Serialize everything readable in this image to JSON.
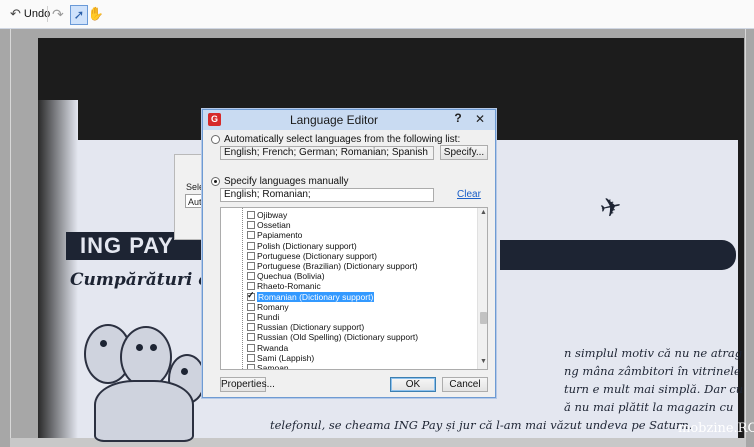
{
  "toolbar": {
    "undo_label": "Undo",
    "undo_icon": "undo-icon",
    "redo_icon": "redo-icon",
    "select_icon": "select-pointer-icon",
    "pan_icon": "hand-icon"
  },
  "background": {
    "dialog_label": "Selec",
    "dialog_input": "Auto",
    "ing_pay": "ING PAY",
    "cumparaturi": "Cumpărături cu",
    "article_left_lines": [
      "telefonul, se cheama ING Pay și jur că l-am mai văzut undeva pe Saturn."
    ],
    "article_right_lines": [
      "n simplul motiv că nu ne atrag",
      "ng mâna zâmbitori în vitrinele",
      "turn e mult mai simplă. Dar cu",
      "ă nu mai plătit la magazin cu"
    ],
    "watermark": "mobzine.RO"
  },
  "dialog": {
    "title": "Language Editor",
    "help": "?",
    "close": "✕",
    "auto_radio_label": "Automatically select languages from the following list:",
    "auto_field_value": "English; French; German; Romanian; Spanish",
    "specify_button": "Specify...",
    "manual_radio_label": "Specify languages manually",
    "manual_field_value": "English; Romanian;",
    "clear_link": "Clear",
    "properties_button": "Properties...",
    "ok_button": "OK",
    "cancel_button": "Cancel",
    "languages": [
      {
        "label": "Ojibway",
        "checked": false,
        "selected": false
      },
      {
        "label": "Ossetian",
        "checked": false,
        "selected": false
      },
      {
        "label": "Papiamento",
        "checked": false,
        "selected": false
      },
      {
        "label": "Polish (Dictionary support)",
        "checked": false,
        "selected": false
      },
      {
        "label": "Portuguese (Dictionary support)",
        "checked": false,
        "selected": false
      },
      {
        "label": "Portuguese (Brazilian) (Dictionary support)",
        "checked": false,
        "selected": false
      },
      {
        "label": "Quechua (Bolivia)",
        "checked": false,
        "selected": false
      },
      {
        "label": "Rhaeto-Romanic",
        "checked": false,
        "selected": false
      },
      {
        "label": "Romanian (Dictionary support)",
        "checked": true,
        "selected": true
      },
      {
        "label": "Romany",
        "checked": false,
        "selected": false
      },
      {
        "label": "Rundi",
        "checked": false,
        "selected": false
      },
      {
        "label": "Russian (Dictionary support)",
        "checked": false,
        "selected": false
      },
      {
        "label": "Russian (Old Spelling) (Dictionary support)",
        "checked": false,
        "selected": false
      },
      {
        "label": "Rwanda",
        "checked": false,
        "selected": false
      },
      {
        "label": "Sami (Lappish)",
        "checked": false,
        "selected": false
      },
      {
        "label": "Samoan",
        "checked": false,
        "selected": false
      }
    ]
  },
  "colors": {
    "accent": "#3399ff",
    "titlebar": "#c9dbf2",
    "brand_navy": "#1d2433",
    "app_icon": "#d62a2a"
  }
}
